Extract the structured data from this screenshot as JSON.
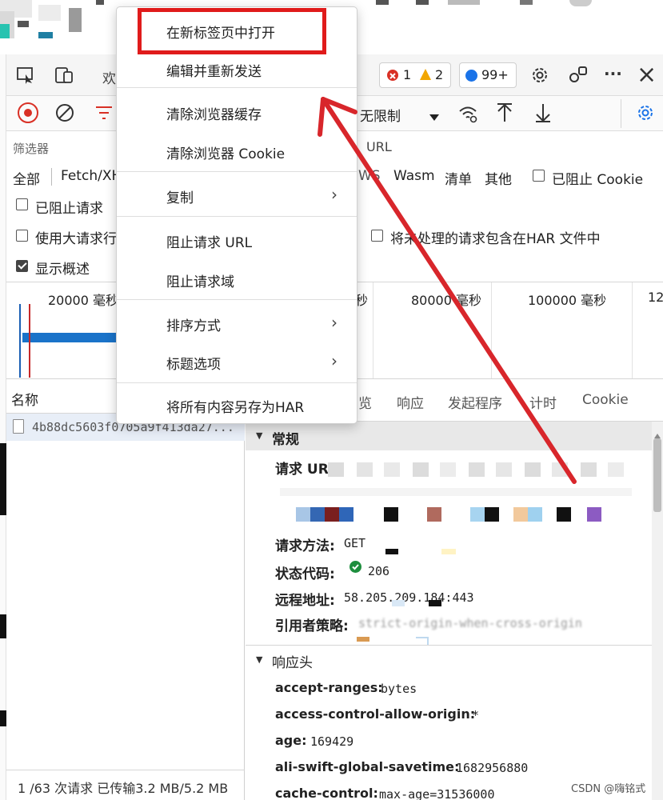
{
  "toolbar": {
    "errors": "1",
    "warnings": "2",
    "messages": "99+",
    "close": "×",
    "more": "···",
    "throttle": "无限制",
    "dock_partial": "欢"
  },
  "filter": {
    "label": "筛选器",
    "url_hint": "URL",
    "types_left": [
      "全部",
      "Fetch/XH"
    ],
    "types_right": [
      "Wasm",
      "清单",
      "其他"
    ],
    "ws": "WS",
    "blocked_cookies": "已阻止 Cookie",
    "blocked_requests": "已阻止请求",
    "large_rows": "使用大请求行",
    "show_overview": "显示概述",
    "har_option": "将未处理的请求包含在HAR 文件中"
  },
  "timeline": {
    "ticks": [
      "20000 毫秒",
      "秒",
      "80000 毫秒",
      "100000 毫秒",
      "12"
    ]
  },
  "request_list": {
    "name_header": "名称",
    "row": "4b88dc5603f0705a9f413da27..."
  },
  "detail_tabs": [
    "览",
    "响应",
    "发起程序",
    "计时",
    "Cookie"
  ],
  "general": {
    "title": "常规",
    "request_url_label": "请求 UR",
    "method_label": "请求方法:",
    "method_value": "GET",
    "status_label": "状态代码:",
    "status_value": "206",
    "remote_label": "远程地址:",
    "remote_value": "58.205.209.184:443",
    "referrer_label": "引用者策略:",
    "referrer_value": "strict-origin-when-cross-origin"
  },
  "response_headers": {
    "title": "响应头",
    "items": [
      {
        "k": "accept-ranges:",
        "v": "bytes"
      },
      {
        "k": "access-control-allow-origin:",
        "v": "*"
      },
      {
        "k": "age:",
        "v": "169429"
      },
      {
        "k": "ali-swift-global-savetime:",
        "v": "1682956880"
      },
      {
        "k": "cache-control:",
        "v": "max-age=31536000"
      }
    ]
  },
  "status_bar": {
    "text": "1 /63 次请求  已传输3.2 MB/5.2 MB"
  },
  "context_menu": {
    "items": [
      "在新标签页中打开",
      "编辑并重新发送",
      "清除浏览器缓存",
      "清除浏览器 Cookie",
      "复制",
      "阻止请求 URL",
      "阻止请求域",
      "排序方式",
      "标题选项",
      "将所有内容另存为HAR"
    ]
  },
  "watermark": "CSDN @嗨铭式",
  "colors": {
    "highlight_box": "#e01b1b",
    "arrow": "#d8262b",
    "record": "#d93025",
    "status_ok": "#1e8e3e",
    "timeline_bar": "#1a73c9"
  }
}
